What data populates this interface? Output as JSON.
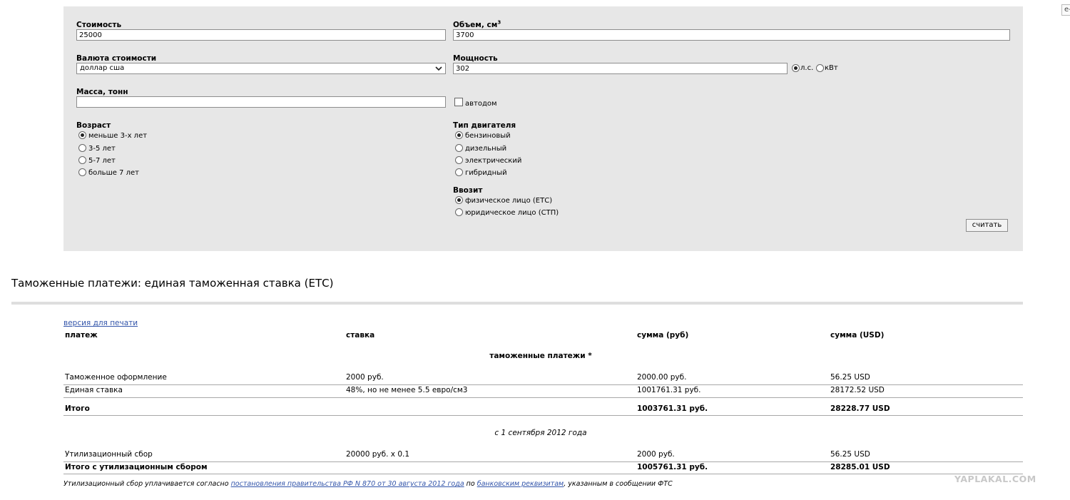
{
  "corner_stub": "e-",
  "form": {
    "cost": {
      "label": "Стоимость",
      "value": "25000"
    },
    "volume": {
      "label": "Объем, см",
      "label_sup": "3",
      "value": "3700"
    },
    "currency": {
      "label": "Валюта стоимости",
      "selected": "доллар сша"
    },
    "power": {
      "label": "Мощность",
      "value": "302",
      "unit_hp": "л.с.",
      "unit_kw": "кВт"
    },
    "mass": {
      "label": "Масса, тонн",
      "value": ""
    },
    "motorhome": {
      "label": "автодом"
    },
    "age": {
      "label": "Возраст",
      "options": [
        "меньше 3-х лет",
        "3-5 лет",
        "5-7 лет",
        "больше 7 лет"
      ]
    },
    "engine": {
      "label": "Тип двигателя",
      "options": [
        "бензиновый",
        "дизельный",
        "электрический",
        "гибридный"
      ]
    },
    "importer": {
      "label": "Ввозит",
      "options": [
        "физическое лицо (ЕТС)",
        "юридическое лицо (СТП)"
      ]
    },
    "calc_button": "считать"
  },
  "results": {
    "title": "Таможенные платежи: единая таможенная ставка (ЕТС)",
    "print_link": "версия для печати",
    "columns": [
      "платеж",
      "ставка",
      "сумма (руб)",
      "сумма (USD)"
    ],
    "section1": "таможенные платежи *",
    "rows1": [
      {
        "name": "Таможенное оформление",
        "rate": "2000 руб.",
        "rub": "2000.00 руб.",
        "usd": "56.25 USD"
      },
      {
        "name": "Единая ставка",
        "rate": "48%, но не менее 5.5 евро/см3",
        "rub": "1001761.31 руб.",
        "usd": "28172.52 USD"
      }
    ],
    "total1": {
      "name": "Итого",
      "rub": "1003761.31 руб.",
      "usd": "28228.77 USD"
    },
    "section2": "с 1 сентября 2012 года",
    "rows2": [
      {
        "name": "Утилизационный сбор",
        "rate": "20000 руб. х 0.1",
        "rub": "2000 руб.",
        "usd": "56.25 USD"
      }
    ],
    "total2": {
      "name": "Итого с утилизационным сбором",
      "rub": "1005761.31 руб.",
      "usd": "28285.01 USD"
    },
    "footnote": {
      "t1": "Утилизационный сбор уплачивается согласно ",
      "link1": "постановления правительства РФ N 870 от 30 августа 2012 года",
      "t2": " по ",
      "link2": "банковским реквизитам",
      "t3": ", указанным в сообщении ФТС"
    }
  },
  "watermark": "YAPLAKAL.COM"
}
